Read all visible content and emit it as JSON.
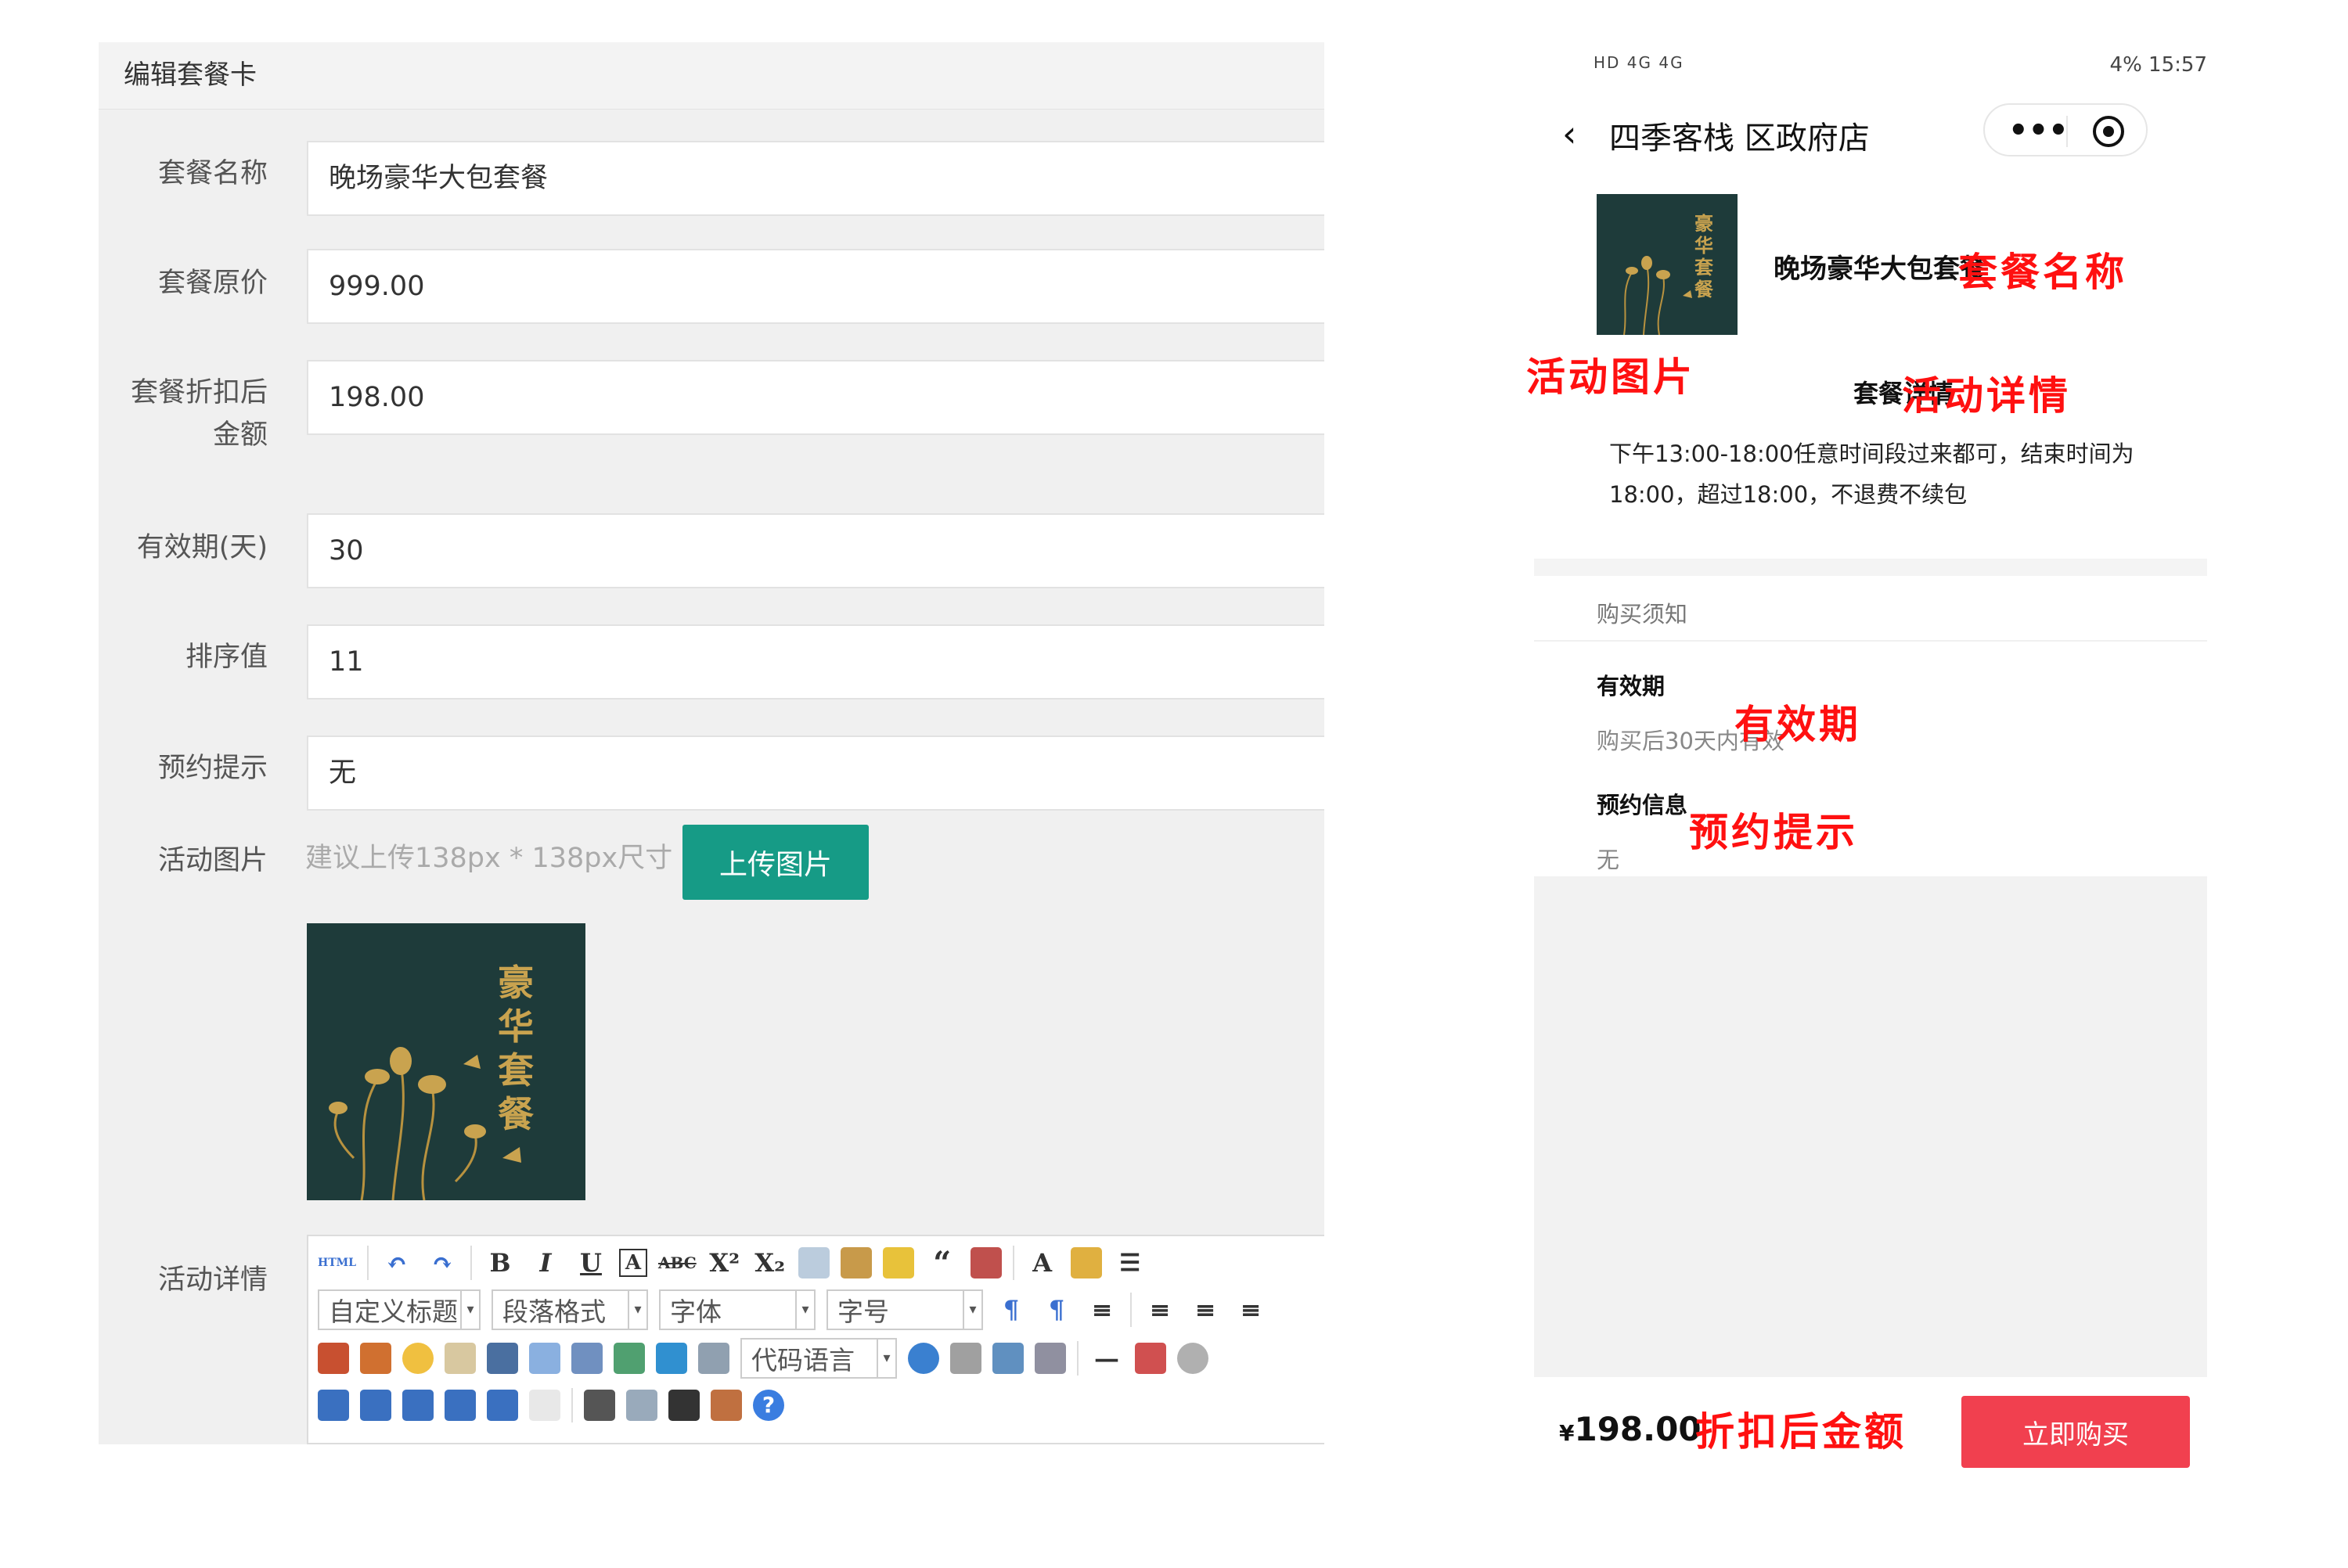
{
  "admin": {
    "title": "编辑套餐卡",
    "fields": {
      "name": {
        "label": "套餐名称",
        "value": "晚场豪华大包套餐"
      },
      "original_price": {
        "label": "套餐原价",
        "value": "999.00"
      },
      "discount_price": {
        "label_line1": "套餐折扣后",
        "label_line2": "金额",
        "value": "198.00"
      },
      "validity": {
        "label": "有效期(天)",
        "value": "30"
      },
      "sort": {
        "label": "排序值",
        "value": "11"
      },
      "reservation": {
        "label": "预约提示",
        "value": "无"
      }
    },
    "image": {
      "label": "活动图片",
      "hint": "建议上传138px * 138px尺寸",
      "upload_button": "上传图片",
      "thumb_text": "豪华套餐"
    },
    "detail": {
      "label": "活动详情"
    },
    "editor": {
      "custom_title": "自定义标题",
      "paragraph_format": "段落格式",
      "font_family": "字体",
      "font_size": "字号",
      "code_language": "代码语言",
      "html_label": "HTML",
      "bold": "B",
      "italic": "I",
      "underline": "U",
      "font_color": "A",
      "help": "?"
    }
  },
  "phone": {
    "status_left": "HD 4G 4G",
    "status_right": "4%  15:57",
    "nav_title": "四季客栈 区政府店",
    "package_name": "晚场豪华大包套餐",
    "thumb_text": "豪华套餐",
    "detail_label": "套餐详情",
    "detail_text": "下午13:00-18:00任意时间段过来都可，结束时间为18:00，超过18:00，不退费不续包",
    "notice_title": "购买须知",
    "validity_title": "有效期",
    "validity_text": "购买后30天内有效",
    "reservation_title": "预约信息",
    "reservation_text": "无",
    "price_symbol": "¥",
    "price": "198.00",
    "buy_button": "立即购买"
  },
  "annotations": {
    "name": "套餐名称",
    "image": "活动图片",
    "detail": "活动详情",
    "validity": "有效期",
    "reservation": "预约提示",
    "discount": "折扣后金额"
  },
  "colors": {
    "accent_green": "#169b86",
    "buy_red": "#f1404f",
    "annotation_red": "#ff1010",
    "thumb_bg": "#1e3b3a",
    "thumb_gold": "#c9a34f"
  }
}
